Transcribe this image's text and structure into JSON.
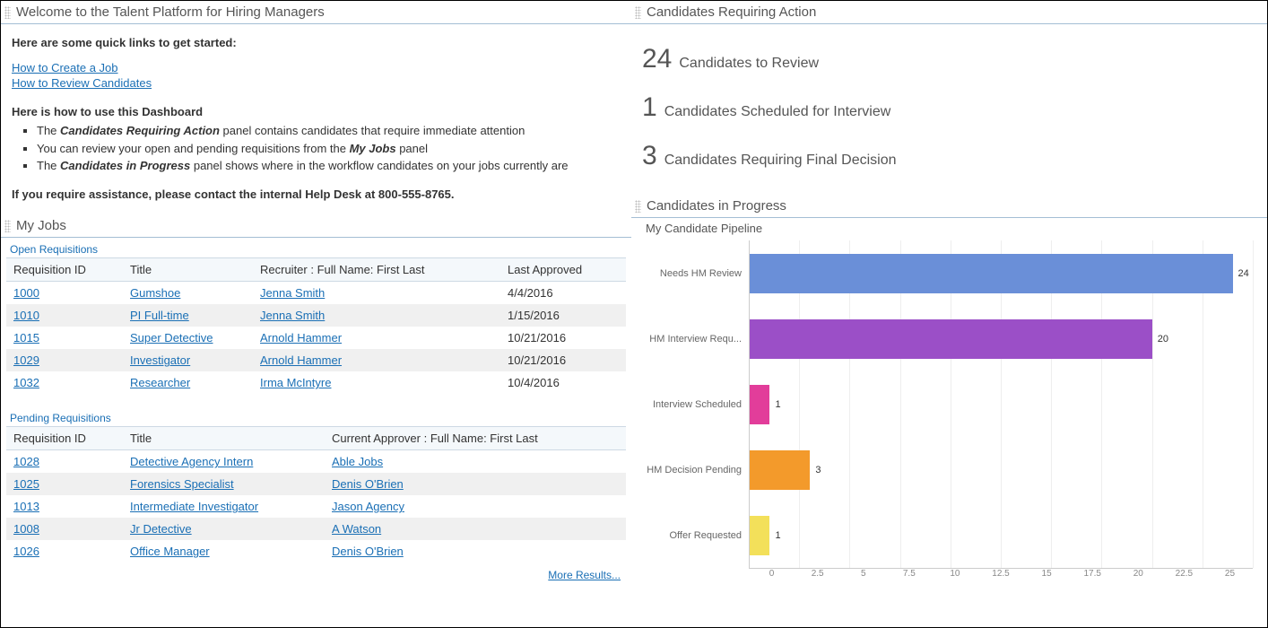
{
  "welcome": {
    "title": "Welcome to the Talent Platform for Hiring Managers",
    "quicklinks_intro": "Here are some quick links to get started:",
    "links": [
      "How to Create a Job",
      "How to Review Candidates"
    ],
    "howto_intro": "Here is how to use this Dashboard",
    "bullets_pre": [
      "The ",
      "You can review your open and pending requisitions from the ",
      "The "
    ],
    "bullets_em": [
      "Candidates Requiring Action",
      "My Jobs",
      "Candidates in Progress"
    ],
    "bullets_post": [
      " panel contains candidates that require immediate attention",
      " panel",
      " panel shows where in the workflow candidates on your jobs currently are"
    ],
    "assist": "If you require assistance, please contact the internal Help Desk at 800-555-8765."
  },
  "myjobs": {
    "title": "My Jobs",
    "open_label": "Open Requisitions",
    "open_headers": [
      "Requisition ID",
      "Title",
      "Recruiter : Full Name: First Last",
      "Last Approved"
    ],
    "open_rows": [
      [
        "1000",
        "Gumshoe",
        "Jenna Smith",
        "4/4/2016"
      ],
      [
        "1010",
        "PI Full-time",
        "Jenna Smith",
        "1/15/2016"
      ],
      [
        "1015",
        "Super Detective",
        "Arnold Hammer",
        "10/21/2016"
      ],
      [
        "1029",
        "Investigator",
        "Arnold Hammer",
        "10/21/2016"
      ],
      [
        "1032",
        "Researcher",
        "Irma McIntyre",
        "10/4/2016"
      ]
    ],
    "pending_label": "Pending Requisitions",
    "pending_headers": [
      "Requisition ID",
      "Title",
      "Current Approver : Full Name: First Last"
    ],
    "pending_rows": [
      [
        "1028",
        "Detective Agency Intern",
        "Able Jobs"
      ],
      [
        "1025",
        "Forensics Specialist",
        "Denis O'Brien"
      ],
      [
        "1013",
        "Intermediate Investigator",
        "Jason Agency"
      ],
      [
        "1008",
        "Jr Detective",
        "A Watson"
      ],
      [
        "1026",
        "Office Manager",
        "Denis O'Brien"
      ]
    ],
    "more": "More Results..."
  },
  "action": {
    "title": "Candidates Requiring Action",
    "items": [
      {
        "num": "24",
        "label": "Candidates to Review"
      },
      {
        "num": "1",
        "label": "Candidates Scheduled for Interview"
      },
      {
        "num": "3",
        "label": "Candidates Requiring Final Decision"
      }
    ]
  },
  "progress": {
    "title": "Candidates in Progress",
    "subtitle": "My Candidate Pipeline"
  },
  "chart_data": {
    "type": "bar",
    "orientation": "horizontal",
    "title": "My Candidate Pipeline",
    "categories": [
      "Needs HM Review",
      "HM Interview Requ...",
      "Interview Scheduled",
      "HM Decision Pending",
      "Offer Requested"
    ],
    "values": [
      24,
      20,
      1,
      3,
      1
    ],
    "colors": [
      "#6a8fd8",
      "#9b4fc7",
      "#e23d9a",
      "#f39a2b",
      "#f3e05a"
    ],
    "xlim": [
      0,
      25
    ],
    "ticks": [
      0,
      2.5,
      5,
      7.5,
      10,
      12.5,
      15,
      17.5,
      20,
      22.5,
      25
    ]
  }
}
